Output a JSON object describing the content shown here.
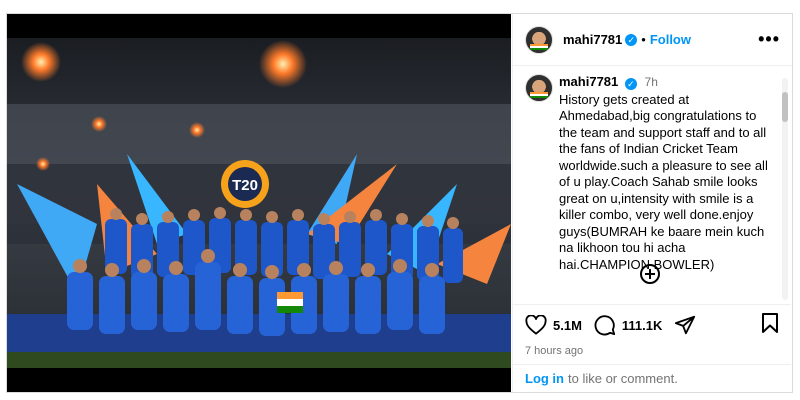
{
  "header": {
    "username": "mahi7781",
    "separator": "•",
    "follow_label": "Follow",
    "more_label": "•••"
  },
  "caption": {
    "username": "mahi7781",
    "time": "7h",
    "text": "History gets created at Ahmedabad,big congratulations to the team and support staff and to all the fans of Indian Cricket Team worldwide.such a pleasure to see all of u play.Coach Sahab smile looks great on u,intensity with smile is a killer combo, very well done.enjoy guys(BUMRAH ke baare mein kuch na likhoon tou hi acha hai.CHAMPION BOWLER)"
  },
  "actions": {
    "likes": "5.1M",
    "comments": "111.1K",
    "posted_ago": "7 hours ago"
  },
  "footer": {
    "login_label": "Log in",
    "login_suffix": "to like or comment."
  },
  "image": {
    "logo_text": "T20"
  },
  "icons": {
    "verified": "verified-badge-icon",
    "like": "heart-icon",
    "comment": "comment-bubble-icon",
    "share": "paper-plane-icon",
    "save": "bookmark-icon",
    "add": "plus-circle-icon",
    "more": "more-options-icon"
  },
  "colors": {
    "accent": "#0095f6",
    "muted": "#737373",
    "border": "#dbdbdb",
    "jersey": "#1d57c9"
  }
}
